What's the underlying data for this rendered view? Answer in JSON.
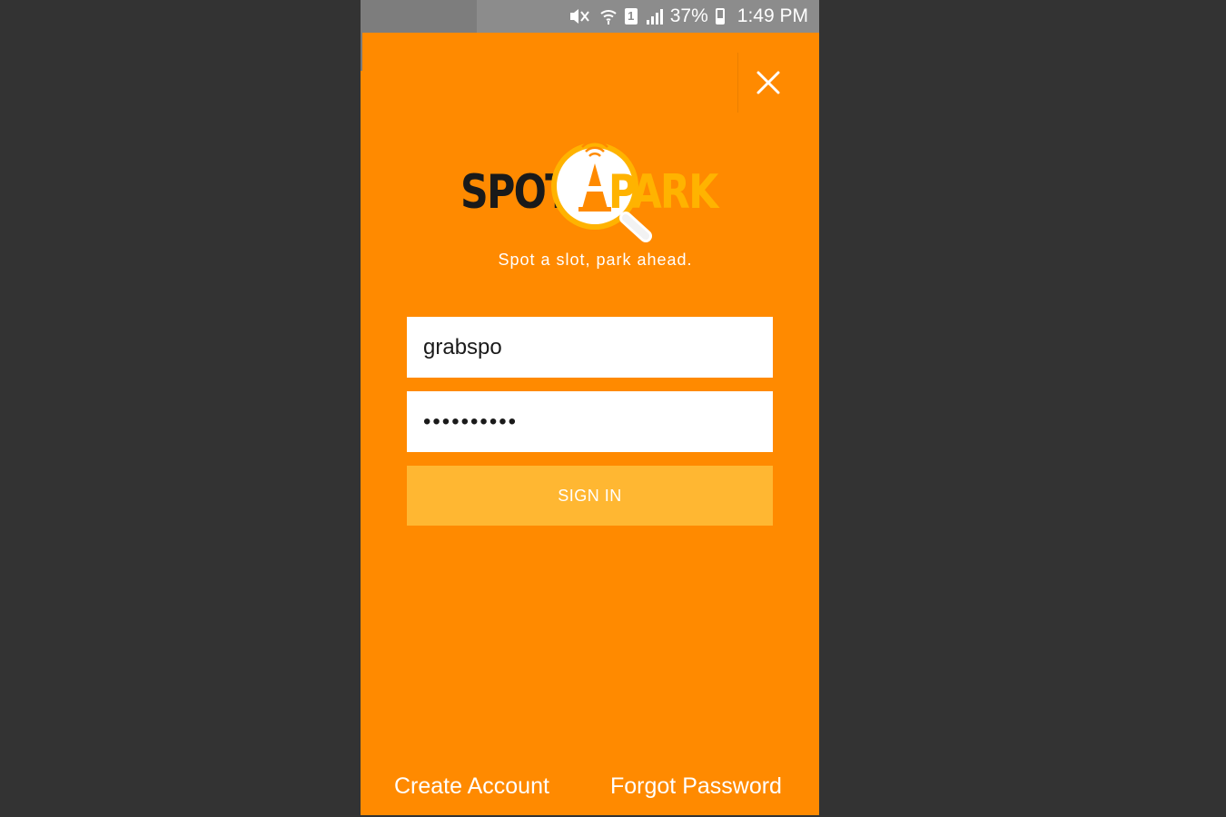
{
  "status_bar": {
    "battery_percent": "37%",
    "battery_level": 0.37,
    "time": "1:49 PM",
    "sim_number": "1",
    "icons": [
      "mute-icon",
      "wifi-icon",
      "sim-icon",
      "signal-icon",
      "battery-icon"
    ]
  },
  "header": {
    "close_icon": "close-icon"
  },
  "brand": {
    "name_part1": "SPOTT",
    "name_part2": "PARK",
    "tagline": "Spot a slot, park ahead.",
    "primary_color": "#ff8a00",
    "accent_color": "#ffb300"
  },
  "login_form": {
    "username_value": "grabspo",
    "password_value": "••••••••••",
    "sign_in_label": "SIGN IN",
    "button_color": "#ffb732"
  },
  "footer": {
    "create_account_label": "Create Account",
    "forgot_password_label": "Forgot Password"
  }
}
